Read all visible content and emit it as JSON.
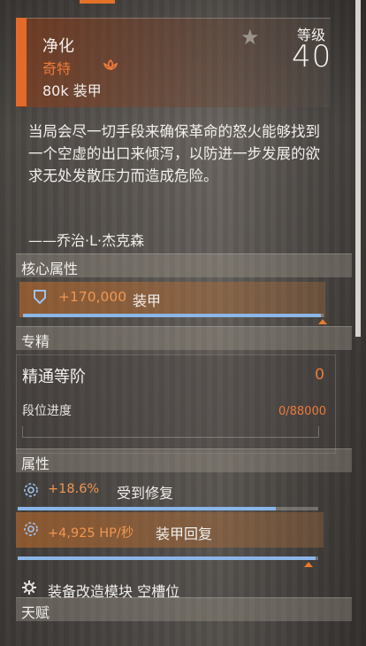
{
  "item": {
    "name": "净化",
    "rarity": "奇特",
    "armor_line": "80k 装甲",
    "level_label": "等级",
    "level_value": "40"
  },
  "description": "当局会尽一切手段来确保革命的怒火能够找到一个空虚的出口来倾泻，以防进一步发展的欲求无处发散压力而造成危险。",
  "quote": "——乔治·L·杰克森",
  "sections": {
    "core": "核心属性",
    "mastery": "专精",
    "attributes": "属性",
    "talents": "天赋"
  },
  "core_attribute": {
    "value": "+170,000",
    "name": "装甲",
    "fill_fraction": 0.99
  },
  "mastery": {
    "title": "精通等阶",
    "value": "0",
    "sub_label": "段位进度",
    "progress": "0/88000"
  },
  "attributes": [
    {
      "value": "+18.6%",
      "name": "受到修复",
      "fill_fraction": 0.86
    },
    {
      "value": "+4,925 HP/秒",
      "name": "装甲回复",
      "fill_fraction": 0.99
    }
  ],
  "mod_slot": "装备改造模块 空槽位",
  "icons": {
    "favorite": "star-icon",
    "rarity": "lotus-icon",
    "core": "shield-icon",
    "attribute": "repair-icon",
    "mod": "gear-icon"
  },
  "colors": {
    "accent": "#e46a2a",
    "value_orange": "#f19550",
    "bar_blue": "#8bb6e8"
  }
}
